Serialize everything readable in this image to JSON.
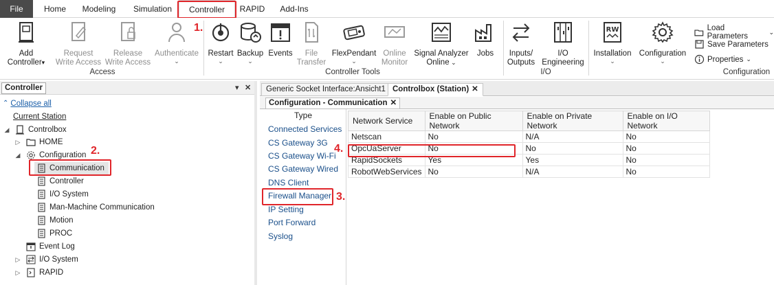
{
  "menu": {
    "tabs": [
      "File",
      "Home",
      "Modeling",
      "Simulation",
      "Controller",
      "RAPID",
      "Add-Ins"
    ]
  },
  "steps": [
    "1.",
    "2.",
    "3.",
    "4."
  ],
  "ribbon": {
    "access": {
      "label": "Access",
      "add_controller": [
        "Add",
        "Controller"
      ],
      "request_write": [
        "Request",
        "Write Access"
      ],
      "release_write": [
        "Release",
        "Write Access"
      ],
      "authenticate": "Authenticate"
    },
    "tools": {
      "label": "Controller Tools",
      "restart": "Restart",
      "backup": "Backup",
      "events": "Events",
      "file_transfer": [
        "File",
        "Transfer"
      ],
      "flexpendant": "FlexPendant",
      "online_monitor": [
        "Online",
        "Monitor"
      ],
      "signal_analyzer": [
        "Signal Analyzer",
        "Online"
      ],
      "jobs": "Jobs"
    },
    "io": {
      "label": "I/O",
      "inputs_outputs": [
        "Inputs/",
        "Outputs"
      ],
      "io_engineering": [
        "I/O",
        "Engineering"
      ]
    },
    "config": {
      "label": "Configuration",
      "installation": "Installation",
      "configuration": "Configuration",
      "load_parameters": "Load Parameters",
      "save_parameters": "Save Parameters",
      "properties": "Properties"
    }
  },
  "left_panel": {
    "title": "Controller",
    "collapse_all": "Collapse all",
    "current_station": "Current Station",
    "controlbox": "Controlbox",
    "home": "HOME",
    "configuration": "Configuration",
    "config_children": [
      "Communication",
      "Controller",
      "I/O System",
      "Man-Machine Communication",
      "Motion",
      "PROC"
    ],
    "event_log": "Event Log",
    "io_system": "I/O System",
    "rapid": "RAPID"
  },
  "doc_tabs": [
    "Generic Socket Interface:Ansicht1",
    "Controlbox (Station)"
  ],
  "sub_tab": "Configuration - Communication",
  "types": {
    "header": "Type",
    "items": [
      "Connected Services",
      "CS Gateway 3G",
      "CS Gateway Wi-Fi",
      "CS Gateway Wired",
      "DNS Client",
      "Firewall Manager",
      "IP Setting",
      "Port Forward",
      "Syslog"
    ]
  },
  "grid": {
    "columns": [
      "Network Service",
      "Enable on Public Network",
      "Enable on Private Network",
      "Enable on I/O Network"
    ],
    "rows": [
      [
        "Netscan",
        "No",
        "N/A",
        "No"
      ],
      [
        "OpcUaServer",
        "No",
        "No",
        "No"
      ],
      [
        "RapidSockets",
        "Yes",
        "Yes",
        "No"
      ],
      [
        "RobotWebServices",
        "No",
        "N/A",
        "No"
      ]
    ]
  },
  "colors": {
    "highlight": "#e0252a",
    "link": "#1a5ea8"
  }
}
